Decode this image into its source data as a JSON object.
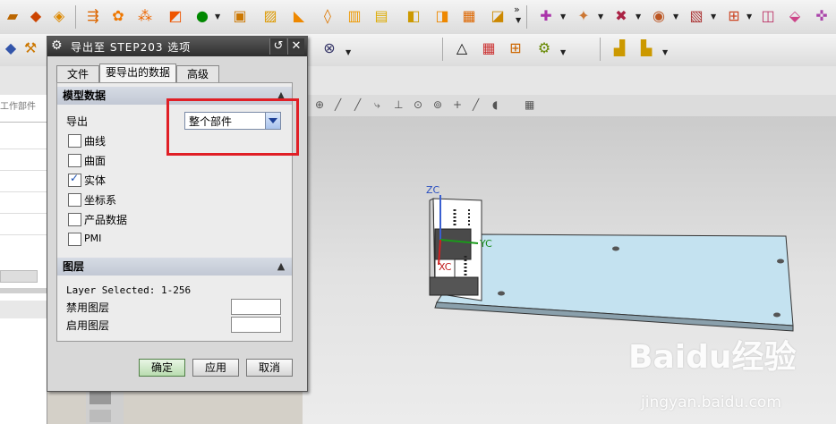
{
  "dialog": {
    "title": "导出至 STEP203 选项",
    "tabs": [
      "文件",
      "要导出的数据",
      "高级"
    ],
    "active_tab": "要导出的数据",
    "model_section": {
      "header": "模型数据",
      "export_label": "导出",
      "export_value": "整个部件",
      "checkboxes": [
        {
          "label": "曲线",
          "checked": false
        },
        {
          "label": "曲面",
          "checked": false
        },
        {
          "label": "实体",
          "checked": true
        },
        {
          "label": "坐标系",
          "checked": false
        },
        {
          "label": "产品数据",
          "checked": false
        },
        {
          "label": "PMI",
          "checked": false
        }
      ]
    },
    "layer_section": {
      "header": "图层",
      "layer_selected": "Layer Selected: 1-256",
      "disable_label": "禁用图层",
      "enable_label": "启用图层"
    },
    "buttons": {
      "ok": "确定",
      "apply": "应用",
      "cancel": "取消"
    }
  },
  "side_label": "工作部件",
  "axes": {
    "z": "ZC",
    "y": "YC",
    "x": "XC"
  },
  "watermark": {
    "text": "Baidu经验",
    "sub": "jingyan.baidu.com"
  },
  "colors": {
    "title_bar": "#3a3a3a",
    "highlight_box": "#e01f26",
    "plate": "#bfe0f0"
  }
}
